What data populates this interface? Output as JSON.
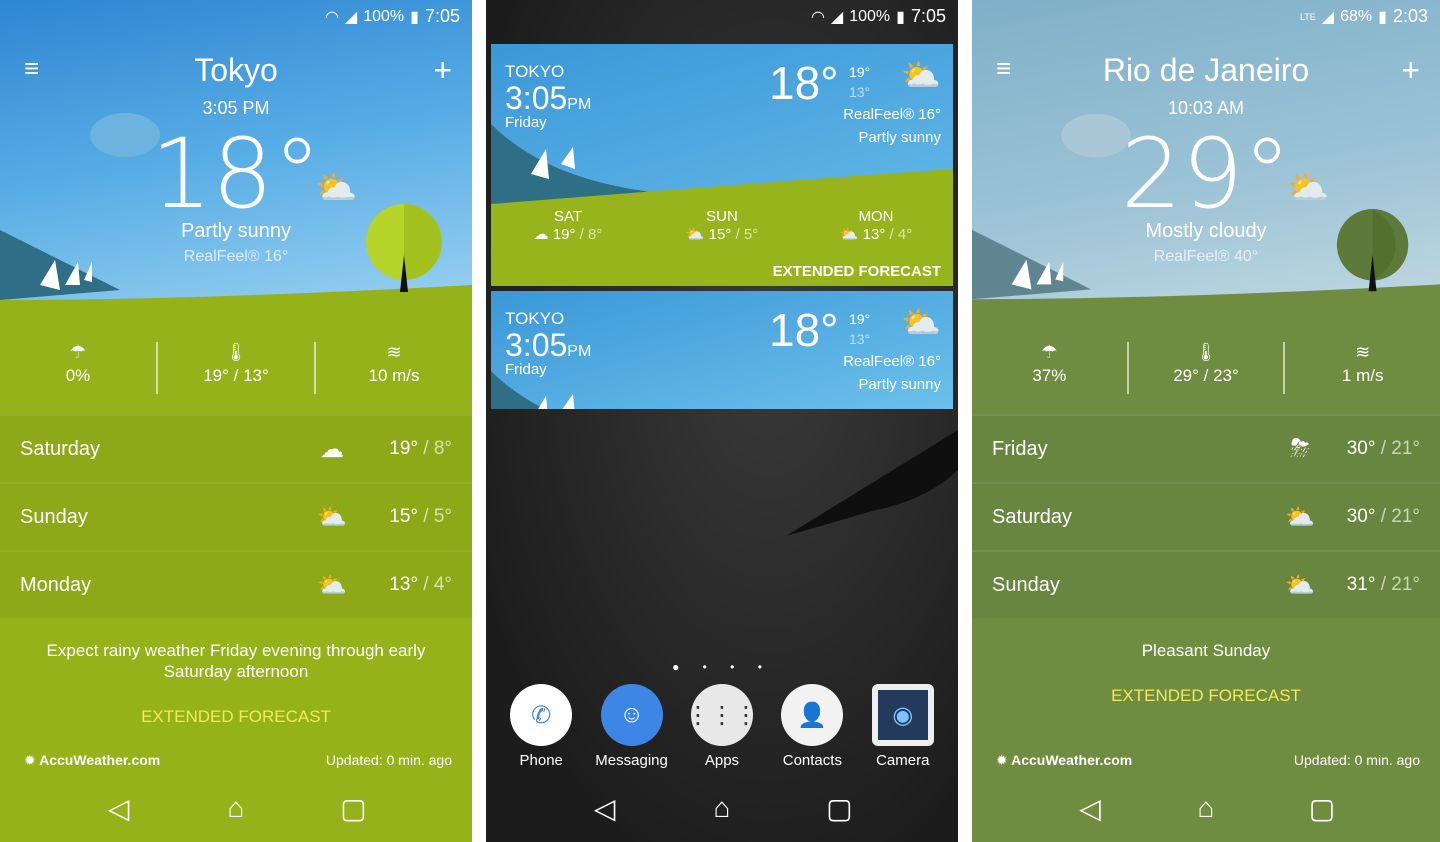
{
  "left": {
    "status": {
      "battery": "100%",
      "time": "7:05"
    },
    "city": "Tokyo",
    "local_time": "3:05 PM",
    "temp": "18°",
    "condition": "Partly sunny",
    "realfeel": "RealFeel® 16°",
    "icon": "partly-sunny-icon",
    "stats": [
      {
        "icon": "umbrella-icon",
        "value": "0%"
      },
      {
        "icon": "thermometer-icon",
        "value": "19° / 13°"
      },
      {
        "icon": "wind-icon",
        "value": "10 m/s"
      }
    ],
    "forecast": [
      {
        "day": "Saturday",
        "icon": "rain-cloud-icon",
        "high": "19°",
        "low": "8°"
      },
      {
        "day": "Sunday",
        "icon": "partly-sunny-icon",
        "high": "15°",
        "low": "5°"
      },
      {
        "day": "Monday",
        "icon": "partly-sunny-icon",
        "high": "13°",
        "low": "4°"
      }
    ],
    "summary": "Expect rainy weather Friday evening through early Saturday afternoon",
    "extended": "EXTENDED FORECAST",
    "brand": "AccuWeather.com",
    "updated": "Updated: 0 min. ago",
    "colors": {
      "sky": "#2f86d2",
      "ground": "#96b21b"
    }
  },
  "middle": {
    "status": {
      "battery": "100%",
      "time": "7:05"
    },
    "widget_large": {
      "city": "TOKYO",
      "time": "3:05",
      "ampm": "PM",
      "day": "Friday",
      "temp": "18°",
      "high": "19°",
      "low": "13°",
      "realfeel": "RealFeel® 16°",
      "condition": "Partly sunny",
      "days": [
        {
          "day": "SAT",
          "icon": "rain-cloud-icon",
          "high": "19°",
          "low": "8°"
        },
        {
          "day": "SUN",
          "icon": "partly-sunny-icon",
          "high": "15°",
          "low": "5°"
        },
        {
          "day": "MON",
          "icon": "partly-sunny-icon",
          "high": "13°",
          "low": "4°"
        }
      ],
      "extended": "EXTENDED FORECAST"
    },
    "widget_small": {
      "city": "TOKYO",
      "time": "3:05",
      "ampm": "PM",
      "day": "Friday",
      "temp": "18°",
      "high": "19°",
      "low": "13°",
      "realfeel": "RealFeel® 16°",
      "condition": "Partly sunny"
    },
    "dock": [
      {
        "label": "Phone",
        "icon": "phone-icon"
      },
      {
        "label": "Messaging",
        "icon": "messaging-icon"
      },
      {
        "label": "Apps",
        "icon": "apps-grid-icon"
      },
      {
        "label": "Contacts",
        "icon": "contacts-icon"
      },
      {
        "label": "Camera",
        "icon": "camera-icon"
      }
    ]
  },
  "right": {
    "status": {
      "network": "LTE",
      "battery": "68%",
      "time": "2:03"
    },
    "city": "Rio de Janeiro",
    "local_time": "10:03 AM",
    "temp": "29°",
    "condition": "Mostly cloudy",
    "realfeel": "RealFeel® 40°",
    "icon": "partly-sunny-icon",
    "stats": [
      {
        "icon": "umbrella-icon",
        "value": "37%"
      },
      {
        "icon": "thermometer-icon",
        "value": "29° / 23°"
      },
      {
        "icon": "wind-icon",
        "value": "1 m/s"
      }
    ],
    "forecast": [
      {
        "day": "Friday",
        "icon": "thunderstorm-icon",
        "high": "30°",
        "low": "21°"
      },
      {
        "day": "Saturday",
        "icon": "partly-sunny-icon",
        "high": "30°",
        "low": "21°"
      },
      {
        "day": "Sunday",
        "icon": "partly-sunny-icon",
        "high": "31°",
        "low": "21°"
      }
    ],
    "summary": "Pleasant Sunday",
    "extended": "EXTENDED FORECAST",
    "brand": "AccuWeather.com",
    "updated": "Updated: 0 min. ago",
    "colors": {
      "sky": "#7fb0c9",
      "ground": "#6f8c40"
    }
  }
}
